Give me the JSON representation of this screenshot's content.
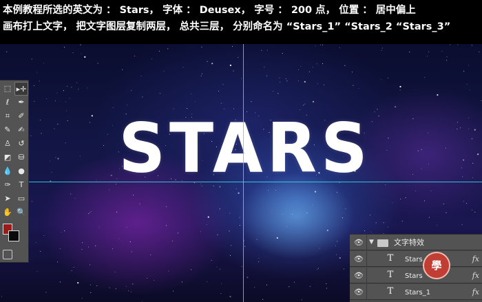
{
  "caption": {
    "line1": "本例教程所选的英文为 ： Stars， 字体 ： Deusex， 字号 ： 200 点， 位置 ： 居中偏上",
    "line2": "画布打上文字， 把文字图层复制两层， 总共三层， 分别命名为 “Stars_1” “Stars_2 “Stars_3”"
  },
  "canvas": {
    "headline": "STARS"
  },
  "toolbox": {
    "tools": [
      {
        "name": "marquee-tool-icon",
        "glyph": "⬚"
      },
      {
        "name": "move-tool-icon",
        "glyph": "▸✛"
      },
      {
        "name": "lasso-tool-icon",
        "glyph": "ℓ"
      },
      {
        "name": "brush-tool-icon",
        "glyph": "✒"
      },
      {
        "name": "crop-tool-icon",
        "glyph": "⌗"
      },
      {
        "name": "eyedropper-tool-icon",
        "glyph": "✐"
      },
      {
        "name": "healing-brush-icon",
        "glyph": "✎"
      },
      {
        "name": "paint-brush-icon",
        "glyph": "✍"
      },
      {
        "name": "clone-stamp-icon",
        "glyph": "♙"
      },
      {
        "name": "history-brush-icon",
        "glyph": "↺"
      },
      {
        "name": "eraser-tool-icon",
        "glyph": "◩"
      },
      {
        "name": "paint-bucket-icon",
        "glyph": "⛁"
      },
      {
        "name": "blur-tool-icon",
        "glyph": "💧"
      },
      {
        "name": "dodge-tool-icon",
        "glyph": "●"
      },
      {
        "name": "pen-tool-icon",
        "glyph": "✑"
      },
      {
        "name": "type-tool-icon",
        "glyph": "T"
      },
      {
        "name": "path-select-icon",
        "glyph": "➤"
      },
      {
        "name": "rectangle-tool-icon",
        "glyph": "▭"
      },
      {
        "name": "hand-tool-icon",
        "glyph": "✋"
      },
      {
        "name": "zoom-tool-icon",
        "glyph": "🔍"
      }
    ],
    "foreground_color": "#9b1b1b",
    "background_color": "#0a0a0a"
  },
  "layers": {
    "group_name": "文字特效",
    "items": [
      {
        "name": "Stars",
        "fx": "fx"
      },
      {
        "name": "Stars",
        "fx": "fx"
      },
      {
        "name": "Stars_1",
        "fx": "fx"
      }
    ]
  },
  "watermark": {
    "glyph": "學"
  }
}
